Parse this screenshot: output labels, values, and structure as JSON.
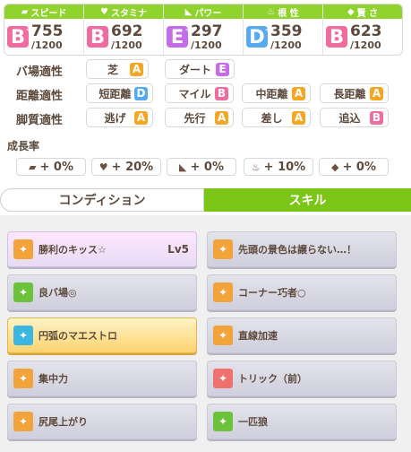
{
  "stats": [
    {
      "name": "スピード",
      "icon": "shoe-icon",
      "grade": "B",
      "plus": "+",
      "value": "755",
      "max": "/1200",
      "color": "#f06b9e"
    },
    {
      "name": "スタミナ",
      "icon": "heart-icon",
      "grade": "B",
      "plus": "",
      "value": "692",
      "max": "/1200",
      "color": "#f06b9e"
    },
    {
      "name": "パワー",
      "icon": "muscle-icon",
      "grade": "E",
      "plus": "+",
      "value": "297",
      "max": "/1200",
      "color": "#c56de8"
    },
    {
      "name": "根 性",
      "icon": "flame-icon",
      "grade": "D",
      "plus": "+",
      "value": "359",
      "max": "/1200",
      "color": "#58aaf0"
    },
    {
      "name": "賢 さ",
      "icon": "graduation-cap-icon",
      "grade": "B",
      "plus": "",
      "value": "623",
      "max": "/1200",
      "color": "#f06b9e"
    }
  ],
  "aptitude": {
    "track_label": "バ場適性",
    "distance_label": "距離適性",
    "style_label": "脚質適性",
    "track": [
      {
        "name": "芝",
        "grade": "A"
      },
      {
        "name": "ダート",
        "grade": "E"
      }
    ],
    "distance": [
      {
        "name": "短距離",
        "grade": "D"
      },
      {
        "name": "マイル",
        "grade": "B"
      },
      {
        "name": "中距離",
        "grade": "A"
      },
      {
        "name": "長距離",
        "grade": "A"
      }
    ],
    "style": [
      {
        "name": "逃げ",
        "grade": "A"
      },
      {
        "name": "先行",
        "grade": "A"
      },
      {
        "name": "差し",
        "grade": "A"
      },
      {
        "name": "追込",
        "grade": "B"
      }
    ]
  },
  "growth": {
    "title": "成長率",
    "items": [
      {
        "icon": "shoe-icon",
        "value": "+ 0%"
      },
      {
        "icon": "heart-icon",
        "value": "+ 20%"
      },
      {
        "icon": "muscle-icon",
        "value": "+ 0%"
      },
      {
        "icon": "flame-icon",
        "value": "+ 10%"
      },
      {
        "icon": "graduation-cap-icon",
        "value": "+ 0%"
      }
    ]
  },
  "tabs": {
    "condition": "コンディション",
    "skill": "スキル"
  },
  "skills": [
    {
      "name": "勝利のキッス☆",
      "level": "Lv5",
      "style": "pink",
      "icon": "unique-skill-icon",
      "icon_color": "#f2a33a"
    },
    {
      "name": "先頭の景色は譲らない…！",
      "level": "",
      "style": "normal",
      "icon": "speed-skill-icon",
      "icon_color": "#f2a33a"
    },
    {
      "name": "良バ場◎",
      "level": "",
      "style": "normal",
      "icon": "track-skill-icon",
      "icon_color": "#6cc23a"
    },
    {
      "name": "コーナー巧者○",
      "level": "",
      "style": "normal",
      "icon": "speed-skill-icon",
      "icon_color": "#f2a33a"
    },
    {
      "name": "円弧のマエストロ",
      "level": "",
      "style": "gold",
      "icon": "recovery-skill-icon",
      "icon_color": "#3ab6e0"
    },
    {
      "name": "直線加速",
      "level": "",
      "style": "normal",
      "icon": "speed-skill-icon",
      "icon_color": "#f2a33a"
    },
    {
      "name": "集中力",
      "level": "",
      "style": "normal",
      "icon": "gate-skill-icon",
      "icon_color": "#f2a33a"
    },
    {
      "name": "トリック（前）",
      "level": "",
      "style": "normal",
      "icon": "debuff-skill-icon",
      "icon_color": "#f07070"
    },
    {
      "name": "尻尾上がり",
      "level": "",
      "style": "normal",
      "icon": "speed-skill-icon",
      "icon_color": "#f2a33a"
    },
    {
      "name": "一匹狼",
      "level": "",
      "style": "normal",
      "icon": "track-skill-icon",
      "icon_color": "#6cc23a"
    }
  ],
  "grade_colors": {
    "A": "#f5a623",
    "B": "#f06b9e",
    "D": "#58aaf0",
    "E": "#c56de8"
  }
}
